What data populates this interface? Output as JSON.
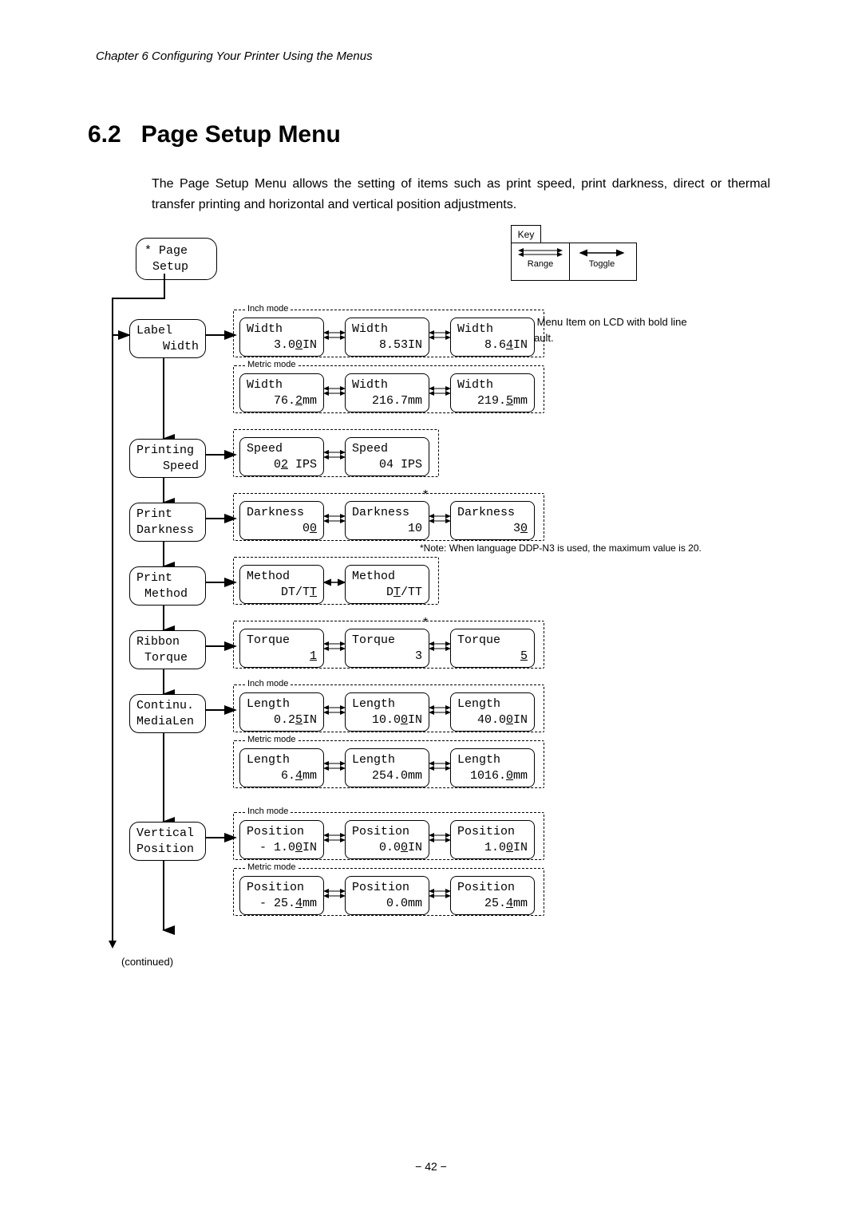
{
  "header": "Chapter 6   Configuring Your Printer Using the Menus",
  "section_number": "6.2",
  "section_title": "Page Setup Menu",
  "intro": "The Page Setup Menu allows the setting of items such as print speed, print darkness, direct or thermal transfer printing and horizontal and vertical position adjustments.",
  "key": {
    "title": "Key",
    "range": "Range",
    "toggle": "Toggle"
  },
  "note_default": "Note: Menu Item on LCD with bold line is default.",
  "note_darkness": "Note: When language DDP-N3 is used, the maximum value is 20.",
  "continued": "(continued)",
  "page_num": "42",
  "root": {
    "l1": "* Page",
    "l2": "Setup"
  },
  "modes": {
    "inch": "Inch mode",
    "metric": "Metric mode"
  },
  "menu": {
    "label_width": {
      "l1": "Label",
      "l2": "Width"
    },
    "printing_speed": {
      "l1": "Printing",
      "l2": "Speed"
    },
    "print_darkness": {
      "l1": "Print",
      "l2": "Darkness"
    },
    "print_method": {
      "l1": "Print",
      "l2": "Method"
    },
    "ribbon_torque": {
      "l1": "Ribbon",
      "l2": "Torque"
    },
    "continu_medialen": {
      "l1": "Continu.",
      "l2": "MediaLen"
    },
    "vertical_position": {
      "l1": "Vertical",
      "l2": "Position"
    }
  },
  "vals": {
    "width_in": {
      "lbl": "Width",
      "a": "3.0",
      "a_sfx": "IN",
      "b": "8.53IN",
      "c": "8.6",
      "c_sfx": "IN",
      "c_u": "4"
    },
    "width_mm": {
      "lbl": "Width",
      "a": "76.",
      "a_sfx": "mm",
      "a_u": "2",
      "b": "216.7mm",
      "c": "219.",
      "c_sfx": "mm",
      "c_u": "5"
    },
    "speed": {
      "lbl": "Speed",
      "a": "0",
      "a_sfx": " IPS",
      "a_u": "2",
      "b": "04 IPS"
    },
    "darkness": {
      "lbl": "Darkness",
      "a": "0",
      "a_u": "0",
      "b": "10",
      "c": "3",
      "c_u": "0"
    },
    "method": {
      "lbl": "Method",
      "a": "DT/T",
      "a_u": "T",
      "b_pre": "D",
      "b_u": "T",
      "b_sfx": "/TT"
    },
    "torque": {
      "lbl": "Torque",
      "a_u": "1",
      "b": "3",
      "c_u": "5"
    },
    "len_in": {
      "lbl": "Length",
      "a": "0.2",
      "a_sfx": "IN",
      "a_u": "5",
      "b": "10.0",
      "b_sfx": "IN",
      "b_u": "0",
      "c": "40.0",
      "c_sfx": "IN",
      "c_u": "0"
    },
    "len_mm": {
      "lbl": "Length",
      "a": "6.",
      "a_sfx": "mm",
      "a_u": "4",
      "b": "254.0mm",
      "c": "1016.",
      "c_sfx": "mm",
      "c_u": "0"
    },
    "pos_in": {
      "lbl": "Position",
      "a": "- 1.0",
      "a_sfx": "IN",
      "a_u": "0",
      "b": "0.0",
      "b_sfx": "IN",
      "b_u": "0",
      "c": "1.0",
      "c_sfx": "IN",
      "c_u": "0"
    },
    "pos_mm": {
      "lbl": "Position",
      "a": "- 25.",
      "a_sfx": "mm",
      "a_u": "4",
      "b": "0.0mm",
      "c": "25.",
      "c_sfx": "mm",
      "c_u": "4"
    }
  }
}
